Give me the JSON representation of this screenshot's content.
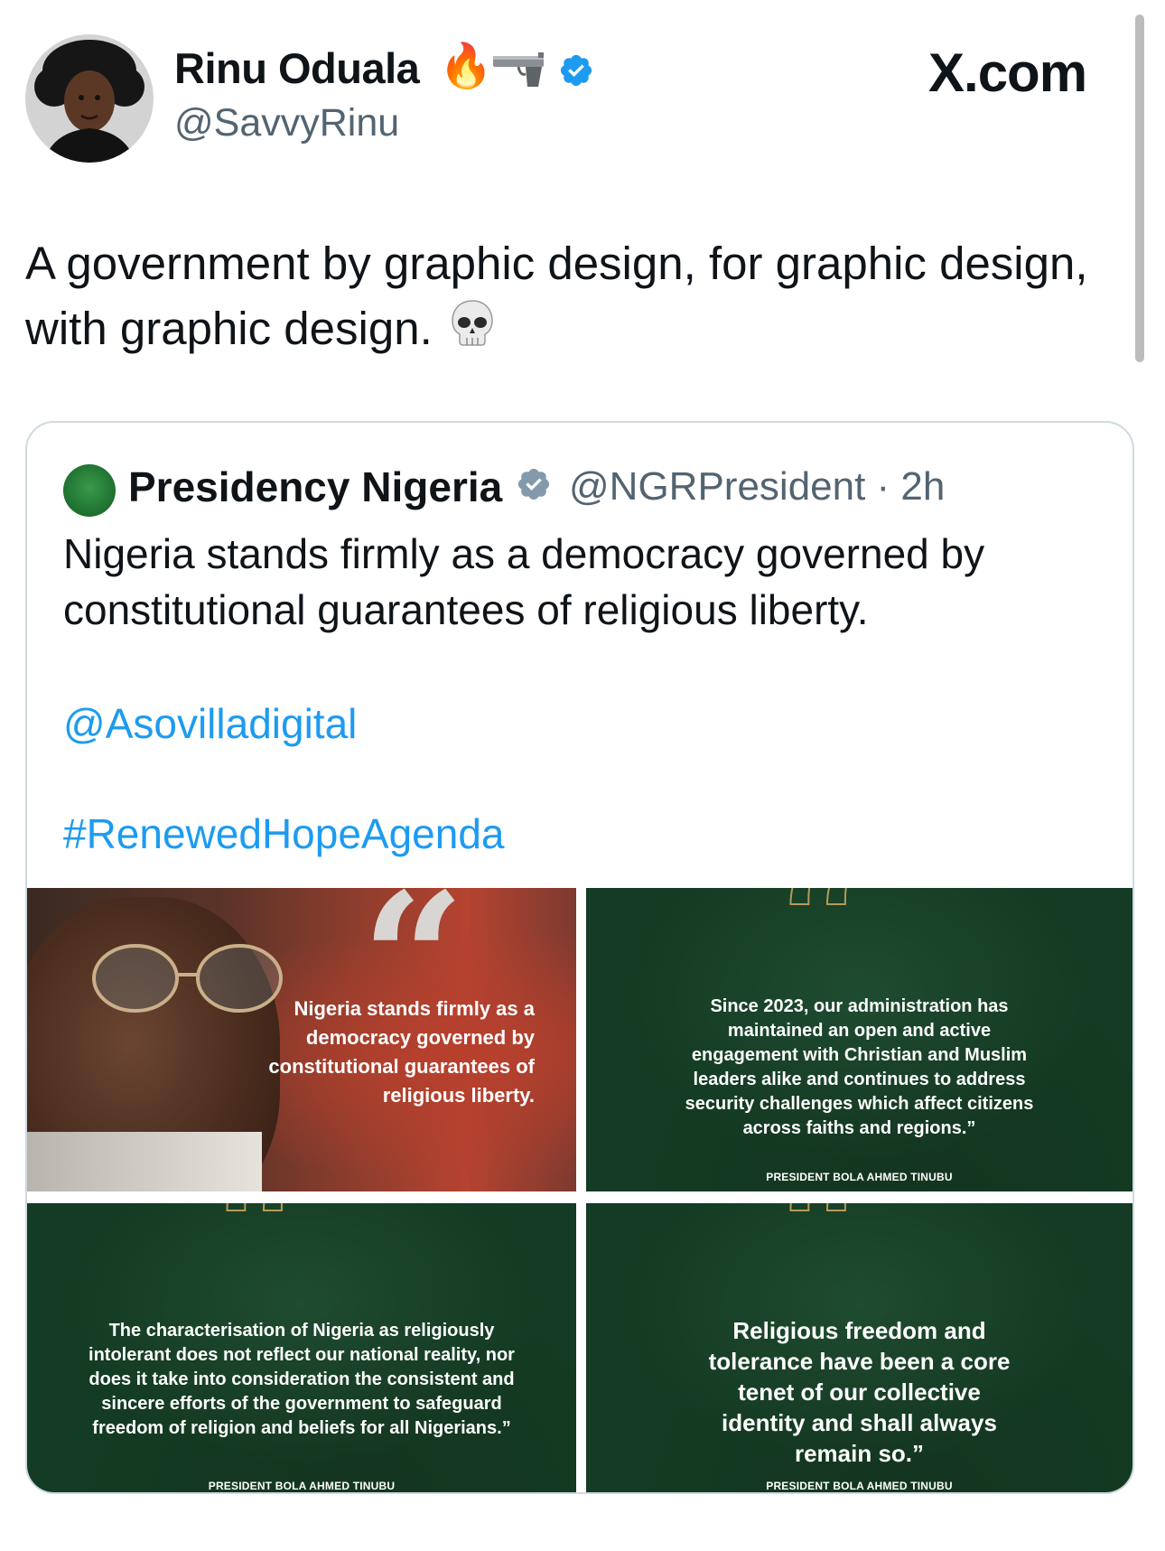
{
  "author": {
    "name": "Rinu Oduala",
    "emoji_1": "🔥",
    "emoji_2": "pistol-icon",
    "handle": "@SavvyRinu"
  },
  "site_label": "X.com",
  "tweet": {
    "text": "A government by graphic design, for graphic design, with graphic design.",
    "emoji": "💀"
  },
  "quoted": {
    "name": "Presidency Nigeria",
    "handle_time": "@NGRPresident · 2h",
    "text": "Nigeria stands firmly as a democracy governed by constitutional guarantees of religious liberty.",
    "mention": "@Asovilladigital",
    "hashtag": "#RenewedHopeAgenda",
    "images": [
      {
        "quote": "Nigeria stands firmly as a democracy governed by constitutional guarantees of religious liberty."
      },
      {
        "quote": "Since 2023, our administration has maintained an open and active engagement with Christian and Muslim leaders alike and continues to address security challenges which affect citizens across faiths and regions.”",
        "attribution": "PRESIDENT BOLA AHMED TINUBU"
      },
      {
        "quote": "The characterisation of Nigeria as religiously intolerant does not reflect our national reality, nor does it take into consideration the consistent and sincere efforts of the government to safeguard freedom of religion and beliefs for all Nigerians.”",
        "attribution": "PRESIDENT BOLA AHMED TINUBU"
      },
      {
        "quote": "Religious freedom and tolerance have been a core tenet of our collective identity and shall always remain so.”",
        "attribution": "PRESIDENT BOLA AHMED TINUBU"
      }
    ]
  },
  "colors": {
    "link": "#1d9bf0",
    "verified": "#1d9bf0",
    "quoted_verified": "#829aab",
    "green_card": "#143b23",
    "gold": "#b79b55"
  }
}
